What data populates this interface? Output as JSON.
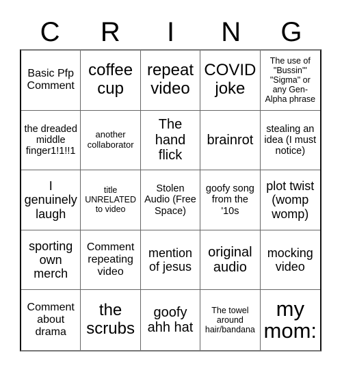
{
  "header": {
    "letters": [
      "C",
      "R",
      "I",
      "N",
      "G"
    ]
  },
  "board": {
    "rows": [
      [
        "Basic Pfp Comment",
        "coffee cup",
        "repeat video",
        "COVID joke",
        "The use of \"Bussin'\" \"Sigma\" or any Gen-Alpha phrase"
      ],
      [
        "the dreaded middle finger1!1!!1",
        "another collaborator",
        "The hand flick",
        "brainrot",
        "stealing an idea (I must notice)"
      ],
      [
        "I genuinely laugh",
        "title UNRELATED to video",
        "Stolen Audio (Free Space)",
        "goofy song from the '10s",
        "plot twist (womp womp)"
      ],
      [
        "sporting own merch",
        "Comment repeating video",
        "mention of jesus",
        "original audio",
        "mocking video"
      ],
      [
        "Comment about drama",
        "the scrubs",
        "goofy ahh hat",
        "The towel around hair/bandana",
        "my mom:"
      ]
    ]
  }
}
